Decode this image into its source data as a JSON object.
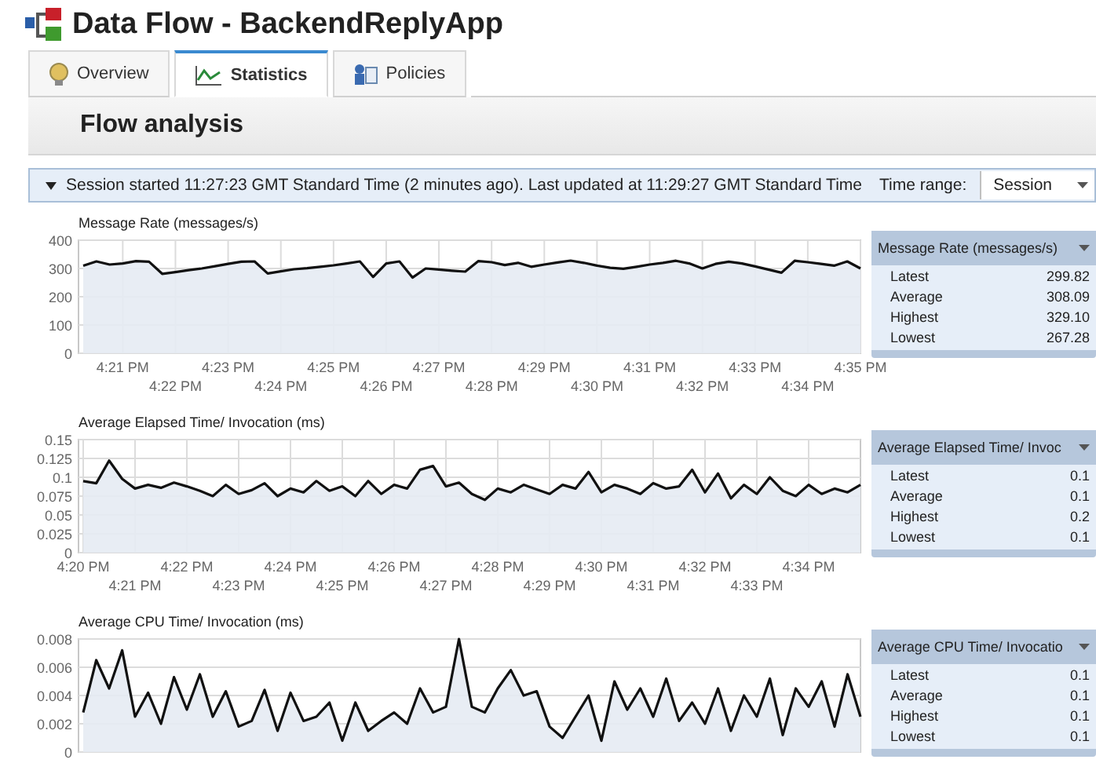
{
  "window": {
    "title": "Data Flow - BackendReplyApp"
  },
  "tabs": [
    {
      "label": "Overview",
      "selected": false,
      "kind": "overview"
    },
    {
      "label": "Statistics",
      "selected": true,
      "kind": "statistics"
    },
    {
      "label": "Policies",
      "selected": false,
      "kind": "policies"
    }
  ],
  "header": {
    "title": "Flow analysis"
  },
  "session_bar": {
    "text": "Session started 11:27:23 GMT Standard Time (2 minutes ago). Last updated at 11:29:27 GMT Standard Time",
    "time_range_label": "Time range:",
    "time_range_value": "Session"
  },
  "charts": [
    {
      "title": "Message Rate (messages/s)",
      "chart_data": {
        "type": "area",
        "grid": true,
        "ylim": [
          0,
          400
        ],
        "yticks": [
          0,
          100,
          200,
          300,
          400
        ],
        "categories": [
          null,
          null,
          null,
          "4:21 PM",
          null,
          null,
          null,
          "4:22 PM",
          null,
          null,
          null,
          "4:23 PM",
          null,
          null,
          null,
          "4:24 PM",
          null,
          null,
          null,
          "4:25 PM",
          null,
          null,
          null,
          "4:26 PM",
          null,
          null,
          null,
          "4:27 PM",
          null,
          null,
          null,
          "4:28 PM",
          null,
          null,
          null,
          "4:29 PM",
          null,
          null,
          null,
          "4:30 PM",
          null,
          null,
          null,
          "4:31 PM",
          null,
          null,
          null,
          "4:32 PM",
          null,
          null,
          null,
          "4:33 PM",
          null,
          null,
          null,
          "4:34 PM",
          null,
          null,
          null,
          "4:35 PM"
        ],
        "series": [
          {
            "color": "#111111",
            "values": [
              310,
              325,
              314,
              318,
              326,
              324,
              281,
              287,
              294,
              300,
              308,
              316,
              324,
              325,
              282,
              290,
              297,
              301,
              306,
              311,
              318,
              325,
              270,
              318,
              325,
              268,
              300,
              296,
              292,
              289,
              326,
              322,
              312,
              320,
              306,
              314,
              321,
              328,
              320,
              310,
              302,
              299,
              306,
              314,
              320,
              327,
              318,
              300,
              316,
              324,
              318,
              307,
              296,
              285,
              327,
              322,
              316,
              310,
              325,
              300
            ]
          }
        ]
      },
      "summary": {
        "title": "Message Rate (messages/s)",
        "rows": [
          {
            "label": "Latest",
            "value": "299.82"
          },
          {
            "label": "Average",
            "value": "308.09"
          },
          {
            "label": "Highest",
            "value": "329.10"
          },
          {
            "label": "Lowest",
            "value": "267.28"
          }
        ]
      }
    },
    {
      "title": "Average Elapsed Time/ Invocation (ms)",
      "chart_data": {
        "type": "area",
        "grid": true,
        "ylim": [
          0,
          0.15
        ],
        "yticks": [
          0,
          0.025,
          0.05,
          0.075,
          0.1,
          0.125,
          0.15
        ],
        "categories": [
          "4:20 PM",
          null,
          null,
          null,
          "4:21 PM",
          null,
          null,
          null,
          "4:22 PM",
          null,
          null,
          null,
          "4:23 PM",
          null,
          null,
          null,
          "4:24 PM",
          null,
          null,
          null,
          "4:25 PM",
          null,
          null,
          null,
          "4:26 PM",
          null,
          null,
          null,
          "4:27 PM",
          null,
          null,
          null,
          "4:28 PM",
          null,
          null,
          null,
          "4:29 PM",
          null,
          null,
          null,
          "4:30 PM",
          null,
          null,
          null,
          "4:31 PM",
          null,
          null,
          null,
          "4:32 PM",
          null,
          null,
          null,
          "4:33 PM",
          null,
          null,
          null,
          "4:34 PM",
          null,
          null,
          null,
          null
        ],
        "series": [
          {
            "color": "#111111",
            "values": [
              0.095,
              0.092,
              0.122,
              0.098,
              0.085,
              0.09,
              0.086,
              0.093,
              0.088,
              0.082,
              0.075,
              0.09,
              0.078,
              0.083,
              0.092,
              0.075,
              0.085,
              0.08,
              0.095,
              0.082,
              0.088,
              0.075,
              0.095,
              0.078,
              0.09,
              0.085,
              0.11,
              0.115,
              0.088,
              0.093,
              0.078,
              0.07,
              0.085,
              0.08,
              0.09,
              0.084,
              0.078,
              0.09,
              0.085,
              0.107,
              0.08,
              0.09,
              0.085,
              0.078,
              0.092,
              0.085,
              0.088,
              0.11,
              0.08,
              0.105,
              0.072,
              0.09,
              0.078,
              0.1,
              0.082,
              0.075,
              0.09,
              0.078,
              0.085,
              0.08,
              0.09
            ]
          }
        ]
      },
      "summary": {
        "title": "Average Elapsed Time/ Invoc",
        "rows": [
          {
            "label": "Latest",
            "value": "0.1"
          },
          {
            "label": "Average",
            "value": "0.1"
          },
          {
            "label": "Highest",
            "value": "0.2"
          },
          {
            "label": "Lowest",
            "value": "0.1"
          }
        ]
      }
    },
    {
      "title": "Average CPU Time/ Invocation (ms)",
      "chart_data": {
        "type": "area",
        "grid": true,
        "ylim": [
          0,
          0.008
        ],
        "yticks": [
          0,
          0.002,
          0.004,
          0.006,
          0.008
        ],
        "series": [
          {
            "color": "#111111",
            "values": [
              0.0028,
              0.0065,
              0.0045,
              0.0072,
              0.0025,
              0.0042,
              0.002,
              0.0053,
              0.003,
              0.0055,
              0.0025,
              0.0043,
              0.0018,
              0.0022,
              0.0044,
              0.0015,
              0.0042,
              0.0022,
              0.0025,
              0.0035,
              0.0008,
              0.0035,
              0.0015,
              0.0022,
              0.0028,
              0.002,
              0.0045,
              0.0028,
              0.0032,
              0.008,
              0.0032,
              0.0028,
              0.0045,
              0.0058,
              0.004,
              0.0043,
              0.0018,
              0.001,
              0.0025,
              0.004,
              0.0008,
              0.005,
              0.003,
              0.0045,
              0.0025,
              0.0052,
              0.0022,
              0.0035,
              0.002,
              0.0045,
              0.0015,
              0.004,
              0.0025,
              0.0052,
              0.0012,
              0.0045,
              0.0032,
              0.005,
              0.0018,
              0.0055,
              0.0025
            ]
          }
        ]
      },
      "summary": {
        "title": "Average CPU Time/ Invocatio",
        "rows": [
          {
            "label": "Latest",
            "value": "0.1"
          },
          {
            "label": "Average",
            "value": "0.1"
          },
          {
            "label": "Highest",
            "value": "0.1"
          },
          {
            "label": "Lowest",
            "value": "0.1"
          }
        ]
      }
    }
  ]
}
